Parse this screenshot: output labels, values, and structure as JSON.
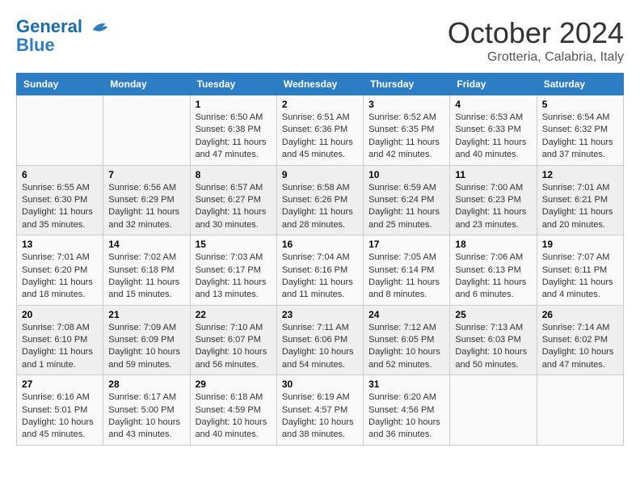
{
  "header": {
    "logo_line1": "General",
    "logo_line2": "Blue",
    "month": "October 2024",
    "location": "Grotteria, Calabria, Italy"
  },
  "days_of_week": [
    "Sunday",
    "Monday",
    "Tuesday",
    "Wednesday",
    "Thursday",
    "Friday",
    "Saturday"
  ],
  "weeks": [
    [
      {
        "day": "",
        "info": ""
      },
      {
        "day": "",
        "info": ""
      },
      {
        "day": "1",
        "info": "Sunrise: 6:50 AM\nSunset: 6:38 PM\nDaylight: 11 hours and 47 minutes."
      },
      {
        "day": "2",
        "info": "Sunrise: 6:51 AM\nSunset: 6:36 PM\nDaylight: 11 hours and 45 minutes."
      },
      {
        "day": "3",
        "info": "Sunrise: 6:52 AM\nSunset: 6:35 PM\nDaylight: 11 hours and 42 minutes."
      },
      {
        "day": "4",
        "info": "Sunrise: 6:53 AM\nSunset: 6:33 PM\nDaylight: 11 hours and 40 minutes."
      },
      {
        "day": "5",
        "info": "Sunrise: 6:54 AM\nSunset: 6:32 PM\nDaylight: 11 hours and 37 minutes."
      }
    ],
    [
      {
        "day": "6",
        "info": "Sunrise: 6:55 AM\nSunset: 6:30 PM\nDaylight: 11 hours and 35 minutes."
      },
      {
        "day": "7",
        "info": "Sunrise: 6:56 AM\nSunset: 6:29 PM\nDaylight: 11 hours and 32 minutes."
      },
      {
        "day": "8",
        "info": "Sunrise: 6:57 AM\nSunset: 6:27 PM\nDaylight: 11 hours and 30 minutes."
      },
      {
        "day": "9",
        "info": "Sunrise: 6:58 AM\nSunset: 6:26 PM\nDaylight: 11 hours and 28 minutes."
      },
      {
        "day": "10",
        "info": "Sunrise: 6:59 AM\nSunset: 6:24 PM\nDaylight: 11 hours and 25 minutes."
      },
      {
        "day": "11",
        "info": "Sunrise: 7:00 AM\nSunset: 6:23 PM\nDaylight: 11 hours and 23 minutes."
      },
      {
        "day": "12",
        "info": "Sunrise: 7:01 AM\nSunset: 6:21 PM\nDaylight: 11 hours and 20 minutes."
      }
    ],
    [
      {
        "day": "13",
        "info": "Sunrise: 7:01 AM\nSunset: 6:20 PM\nDaylight: 11 hours and 18 minutes."
      },
      {
        "day": "14",
        "info": "Sunrise: 7:02 AM\nSunset: 6:18 PM\nDaylight: 11 hours and 15 minutes."
      },
      {
        "day": "15",
        "info": "Sunrise: 7:03 AM\nSunset: 6:17 PM\nDaylight: 11 hours and 13 minutes."
      },
      {
        "day": "16",
        "info": "Sunrise: 7:04 AM\nSunset: 6:16 PM\nDaylight: 11 hours and 11 minutes."
      },
      {
        "day": "17",
        "info": "Sunrise: 7:05 AM\nSunset: 6:14 PM\nDaylight: 11 hours and 8 minutes."
      },
      {
        "day": "18",
        "info": "Sunrise: 7:06 AM\nSunset: 6:13 PM\nDaylight: 11 hours and 6 minutes."
      },
      {
        "day": "19",
        "info": "Sunrise: 7:07 AM\nSunset: 6:11 PM\nDaylight: 11 hours and 4 minutes."
      }
    ],
    [
      {
        "day": "20",
        "info": "Sunrise: 7:08 AM\nSunset: 6:10 PM\nDaylight: 11 hours and 1 minute."
      },
      {
        "day": "21",
        "info": "Sunrise: 7:09 AM\nSunset: 6:09 PM\nDaylight: 10 hours and 59 minutes."
      },
      {
        "day": "22",
        "info": "Sunrise: 7:10 AM\nSunset: 6:07 PM\nDaylight: 10 hours and 56 minutes."
      },
      {
        "day": "23",
        "info": "Sunrise: 7:11 AM\nSunset: 6:06 PM\nDaylight: 10 hours and 54 minutes."
      },
      {
        "day": "24",
        "info": "Sunrise: 7:12 AM\nSunset: 6:05 PM\nDaylight: 10 hours and 52 minutes."
      },
      {
        "day": "25",
        "info": "Sunrise: 7:13 AM\nSunset: 6:03 PM\nDaylight: 10 hours and 50 minutes."
      },
      {
        "day": "26",
        "info": "Sunrise: 7:14 AM\nSunset: 6:02 PM\nDaylight: 10 hours and 47 minutes."
      }
    ],
    [
      {
        "day": "27",
        "info": "Sunrise: 6:16 AM\nSunset: 5:01 PM\nDaylight: 10 hours and 45 minutes."
      },
      {
        "day": "28",
        "info": "Sunrise: 6:17 AM\nSunset: 5:00 PM\nDaylight: 10 hours and 43 minutes."
      },
      {
        "day": "29",
        "info": "Sunrise: 6:18 AM\nSunset: 4:59 PM\nDaylight: 10 hours and 40 minutes."
      },
      {
        "day": "30",
        "info": "Sunrise: 6:19 AM\nSunset: 4:57 PM\nDaylight: 10 hours and 38 minutes."
      },
      {
        "day": "31",
        "info": "Sunrise: 6:20 AM\nSunset: 4:56 PM\nDaylight: 10 hours and 36 minutes."
      },
      {
        "day": "",
        "info": ""
      },
      {
        "day": "",
        "info": ""
      }
    ]
  ]
}
